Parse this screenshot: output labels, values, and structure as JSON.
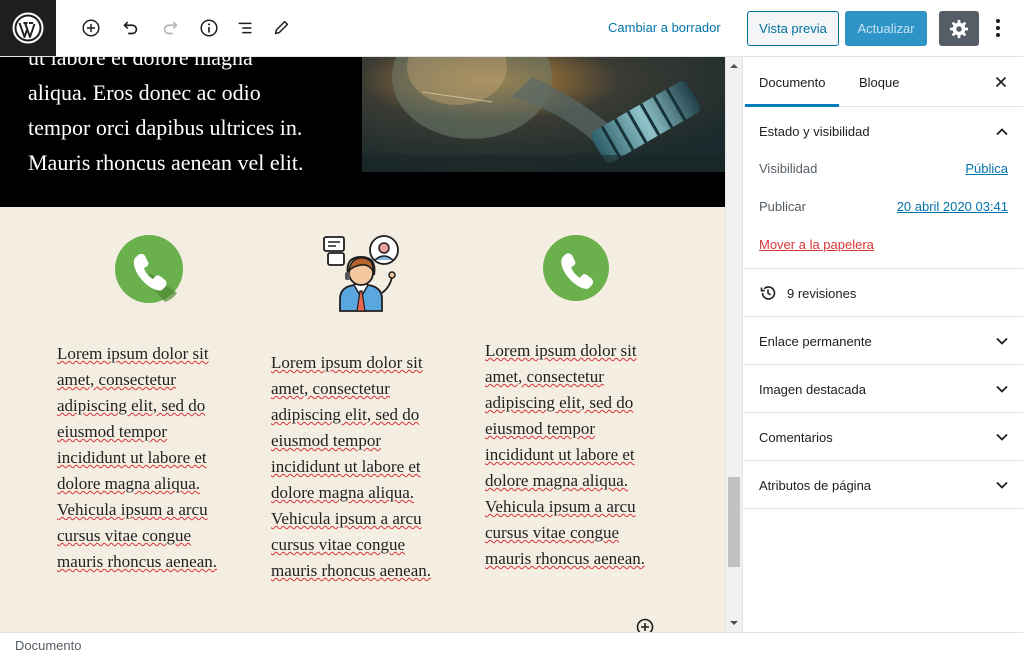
{
  "toolbar": {
    "switch_to_draft": "Cambiar a borrador",
    "preview": "Vista previa",
    "update": "Actualizar"
  },
  "hero": {
    "lines": [
      "ut labore et dolore magna",
      "aliqua. Eros donec ac odio",
      "tempor orci dapibus ultrices in.",
      "Mauris rhoncus aenean vel elit."
    ]
  },
  "columns": [
    {
      "icon": "phone-icon",
      "lines": [
        "Lorem ipsum dolor sit",
        "amet, consectetur",
        "adipiscing elit, sed do",
        "eiusmod tempor",
        "incididunt ut labore et",
        "dolore magna aliqua.",
        "Vehicula ipsum a arcu",
        "cursus vitae congue",
        "mauris rhoncus aenean."
      ]
    },
    {
      "icon": "support-agent-icon",
      "lines": [
        "Lorem ipsum dolor sit",
        "amet, consectetur",
        "adipiscing elit, sed do",
        "eiusmod tempor",
        "incididunt ut labore et",
        "dolore magna aliqua.",
        "Vehicula ipsum a arcu",
        "cursus vitae congue",
        "mauris rhoncus aenean."
      ]
    },
    {
      "icon": "phone-icon",
      "lines": [
        "Lorem ipsum dolor sit",
        "amet, consectetur",
        "adipiscing elit, sed do",
        "eiusmod tempor",
        "incididunt ut labore et",
        "dolore magna aliqua.",
        "Vehicula ipsum a arcu",
        "cursus vitae congue",
        "mauris rhoncus aenean."
      ]
    }
  ],
  "sidebar": {
    "tabs": [
      {
        "label": "Documento",
        "active": true
      },
      {
        "label": "Bloque",
        "active": false
      }
    ],
    "status": {
      "title": "Estado y visibilidad",
      "visibility_label": "Visibilidad",
      "visibility_value": "Pública",
      "publish_label": "Publicar",
      "publish_value": "20 abril 2020 03:41",
      "trash": "Mover a la papelera"
    },
    "revisions": "9 revisiones",
    "panels": [
      "Enlace permanente",
      "Imagen destacada",
      "Comentarios",
      "Atributos de página"
    ]
  },
  "footer": {
    "breadcrumb": "Documento"
  },
  "colors": {
    "accent": "#007cba",
    "update_button": "#2e94c7",
    "editor_background": "#f4ede2",
    "phone_green": "#6ab04c"
  }
}
